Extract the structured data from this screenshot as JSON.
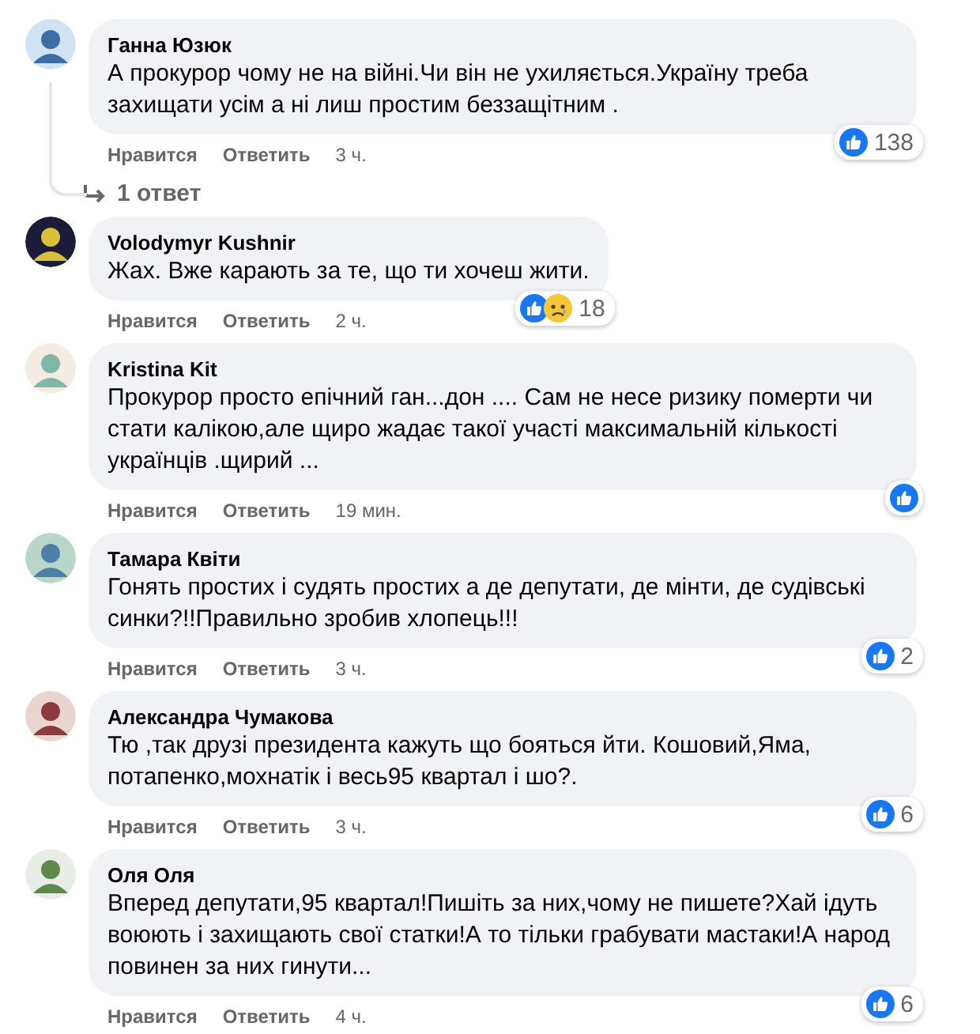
{
  "comments": [
    {
      "author": "Ганна Юзюк",
      "text": "А прокурор чому не на війні.Чи він не ухиляється.Україну треба захищати усім а ні лиш простим беззащітним .",
      "actions": [
        "Нравится",
        "Ответить"
      ],
      "time": "3 ч.",
      "reactions": [
        {
          "kind": "like"
        }
      ],
      "reaction_count": "138",
      "replies_link": "1 ответ"
    },
    {
      "author": "Volodymyr Kushnir",
      "text": "Жах. Вже карають за те, що ти хочеш жити.",
      "actions": [
        "Нравится",
        "Ответить"
      ],
      "time": "2 ч.",
      "reactions": [
        {
          "kind": "like"
        },
        {
          "kind": "sad"
        }
      ],
      "reaction_count": "18"
    },
    {
      "author": "Kristina Kit",
      "text": "Прокурор просто епічний ган...дон .... Сам не несе ризику померти чи стати калікою,але щиро жадає такої участі максимальній кількості українців .щирий ...",
      "actions": [
        "Нравится",
        "Ответить"
      ],
      "time": "19 мин.",
      "reactions": [
        {
          "kind": "like"
        }
      ]
    },
    {
      "author": "Тамара Квіти",
      "text": "Гонять простих і судять простих а де депутати, де мінти, де судівські синки?!!Правильно зробив хлопець!!!",
      "actions": [
        "Нравится",
        "Ответить"
      ],
      "time": "3 ч.",
      "reactions": [
        {
          "kind": "like"
        }
      ],
      "reaction_count": "2"
    },
    {
      "author": "Александра Чумакова",
      "text": "Тю ,так друзі президента кажуть що бояться йти. Кошовий,Яма, потапенко,мохнатік і весь95 квартал і шо?.",
      "actions": [
        "Нравится",
        "Ответить"
      ],
      "time": "3 ч.",
      "reactions": [
        {
          "kind": "like"
        }
      ],
      "reaction_count": "6"
    },
    {
      "author": "Оля Оля",
      "text": "Вперед депутати,95 квартал!Пишіть за них,чому не пишете?Хай ідуть воюють і захищають свої статки!А то тільки грабувати мастаки!А народ повинен за них гинути...",
      "actions": [
        "Нравится",
        "Ответить"
      ],
      "time": "4 ч.",
      "reactions": [
        {
          "kind": "like"
        }
      ],
      "reaction_count": "6"
    }
  ]
}
